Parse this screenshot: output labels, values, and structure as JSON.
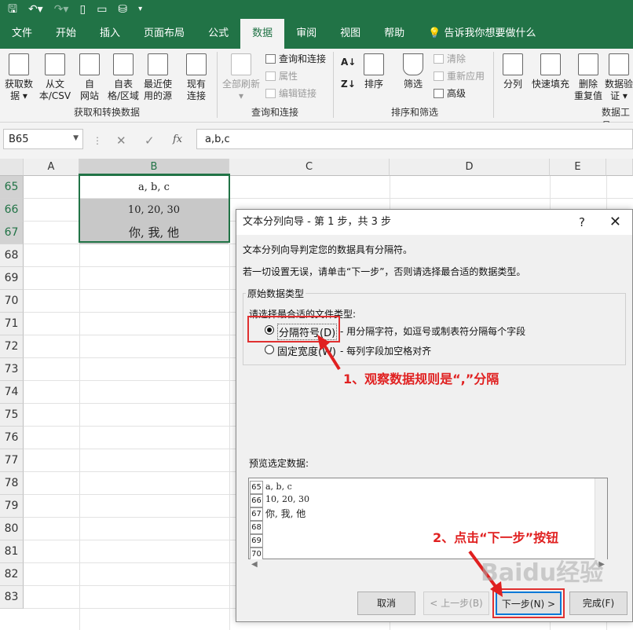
{
  "ribbon_tabs": [
    "文件",
    "开始",
    "插入",
    "页面布局",
    "公式",
    "数据",
    "审阅",
    "视图",
    "帮助"
  ],
  "tell_me": "告诉我你想要做什么",
  "ribbon": {
    "get_data": [
      "获取数",
      "据 ▾"
    ],
    "from_csv": [
      "从文",
      "本/CSV"
    ],
    "from_web": [
      "自",
      "网站"
    ],
    "from_table": [
      "自表",
      "格/区域"
    ],
    "recent": [
      "最近使",
      "用的源"
    ],
    "existing": [
      "现有",
      "连接"
    ],
    "group_get": "获取和转换数据",
    "refresh_all": [
      "全部刷新",
      "▾"
    ],
    "queries": "查询和连接",
    "properties": "属性",
    "edit_links": "编辑链接",
    "group_queries": "查询和连接",
    "sort": "排序",
    "filter": "筛选",
    "clear": "清除",
    "reapply": "重新应用",
    "advanced": "高级",
    "group_sort": "排序和筛选",
    "split": "分列",
    "flash_fill": "快速填充",
    "remove_dup": [
      "删除",
      "重复值"
    ],
    "validate": [
      "数据验",
      "证 ▾"
    ],
    "group_tools": "数据工具"
  },
  "name_box": "B65",
  "formula": "a,b,c",
  "fx": "fx",
  "columns": [
    "A",
    "B",
    "C",
    "D",
    "E"
  ],
  "rows": [
    "65",
    "66",
    "67",
    "68",
    "69",
    "70",
    "71",
    "72",
    "73",
    "74",
    "75",
    "76",
    "77",
    "78",
    "79",
    "80",
    "81",
    "82",
    "83"
  ],
  "cells": [
    "a, b, c",
    "10, 20, 30",
    "你, 我, 他"
  ],
  "dialog": {
    "title": "文本分列向导 - 第 1 步，共 3 步",
    "help": "?",
    "close": "✕",
    "line1": "文本分列向导判定您的数据具有分隔符。",
    "line2": "若一切设置无误，请单击“下一步”，否则请选择最合适的数据类型。",
    "group_label": "原始数据类型",
    "choose_label": "请选择最合适的文件类型:",
    "opt_delim": "分隔符号(D)",
    "opt_delim_desc": "- 用分隔字符，如逗号或制表符分隔每个字段",
    "opt_fixed": "固定宽度(W)",
    "opt_fixed_desc": "- 每列字段加空格对齐",
    "preview_label": "预览选定数据:",
    "preview_rows": [
      "65",
      "66",
      "67",
      "68",
      "69",
      "70"
    ],
    "preview_text": [
      "a, b, c",
      "10, 20, 30",
      "你, 我, 他"
    ],
    "cancel": "取消",
    "back": "< 上一步(B)",
    "next": "下一步(N) >",
    "finish": "完成(F)"
  },
  "annotations": {
    "a1": "1、观察数据规则是“,”分隔",
    "a2": "2、点击“下一步”按钮"
  },
  "watermark": "Baidu经验",
  "colors": {
    "excel_green": "#217346",
    "annot_red": "#e02020"
  }
}
